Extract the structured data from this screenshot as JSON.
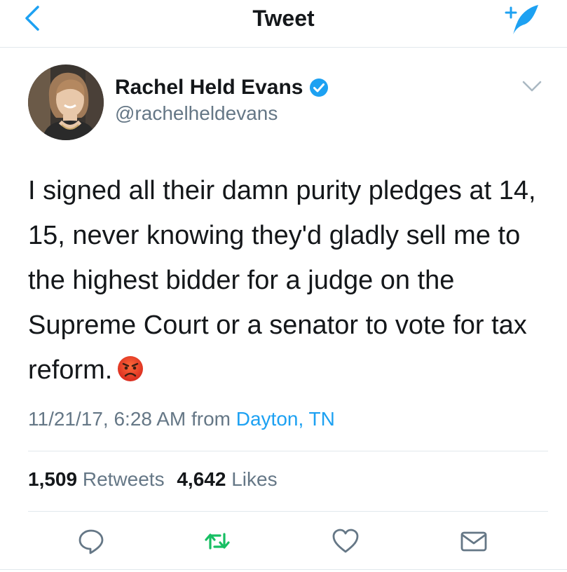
{
  "header": {
    "title": "Tweet",
    "back_icon": "chevron-left-icon",
    "compose_icon": "compose-tweet-icon"
  },
  "tweet": {
    "author_name": "Rachel Held Evans",
    "handle": "@rachelheldevans",
    "text": "I signed all their damn purity pledges at 14, 15, never knowing they'd gladly sell me to the highest bidder for a judge on the Supreme Court or a senator to vote for tax reform.",
    "emoji": "angry-face-icon",
    "timestamp": "11/21/17, 6:28 AM",
    "from_label": "from",
    "location": "Dayton, TN"
  },
  "stats": {
    "retweets_count": "1,509",
    "retweets_label": "Retweets",
    "likes_count": "4,642",
    "likes_label": "Likes"
  },
  "colors": {
    "accent": "#1da1f2",
    "retweet": "#17bf63",
    "secondary": "#657786",
    "angry": "#e0362b"
  }
}
